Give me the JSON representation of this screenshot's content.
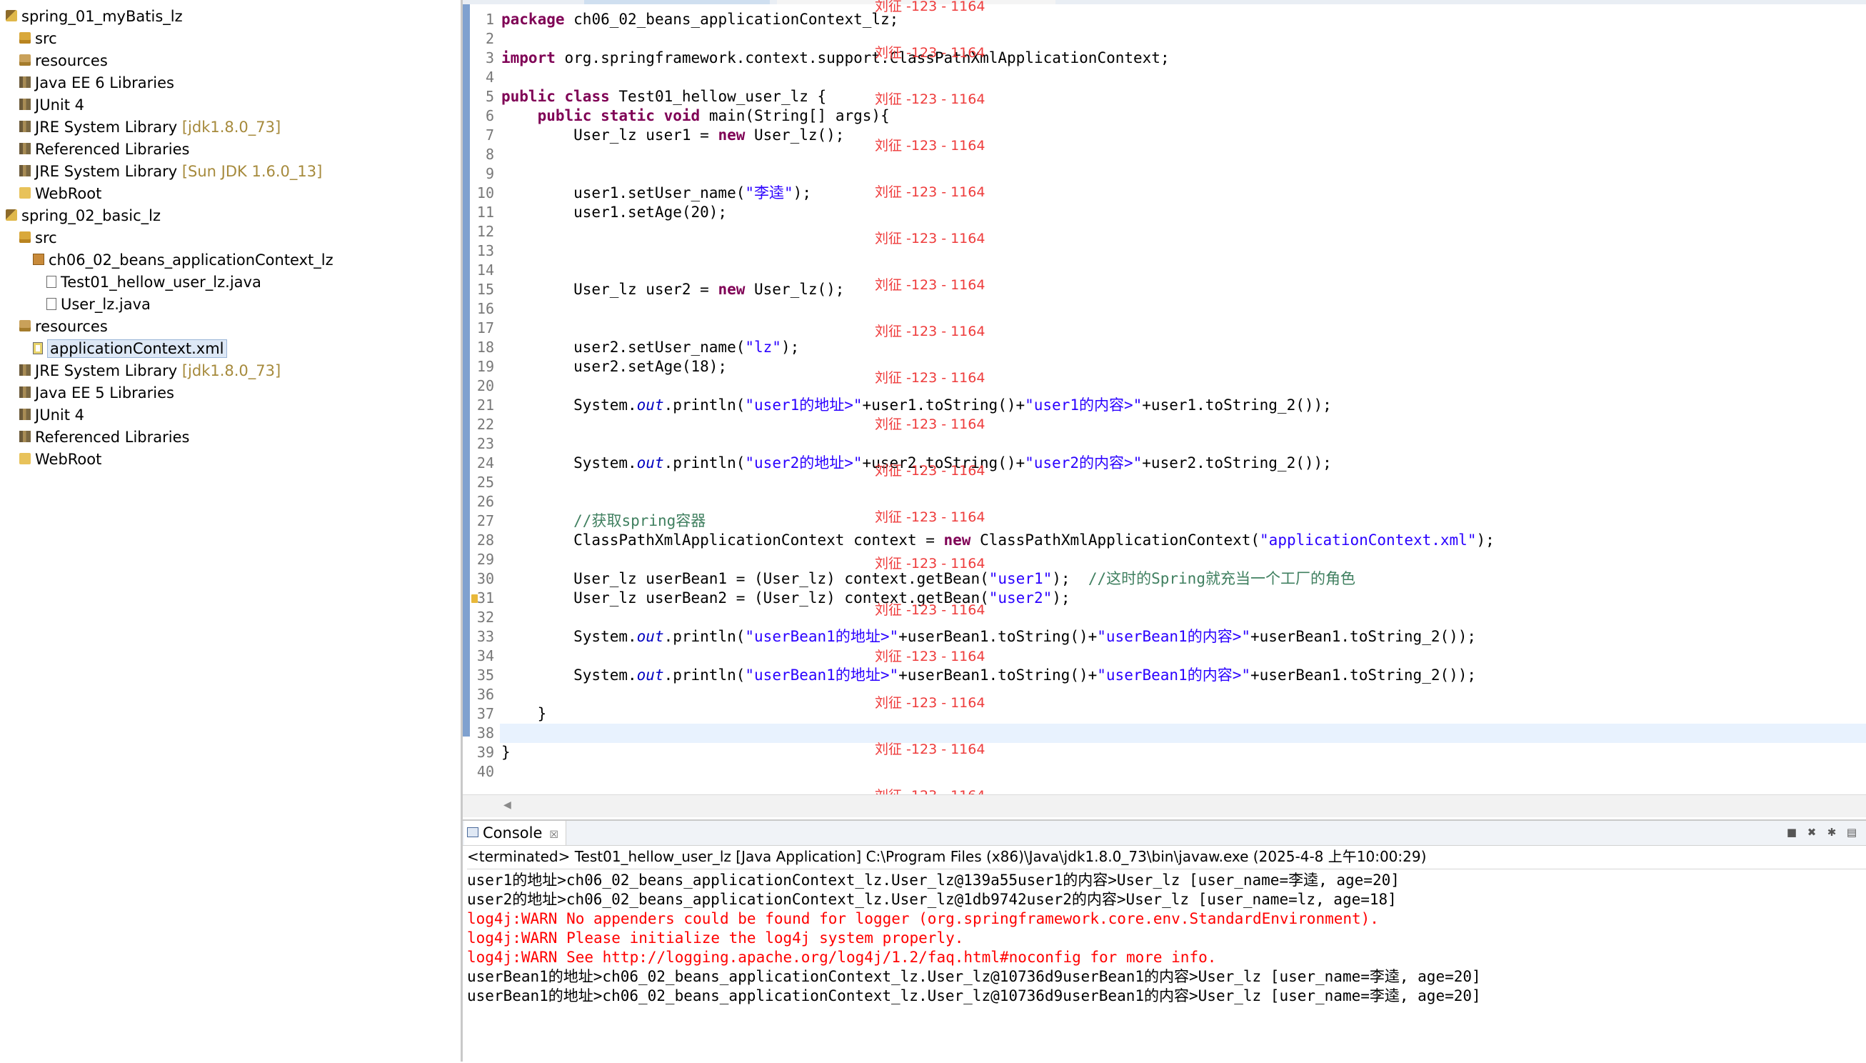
{
  "explorer": {
    "items": [
      {
        "label": "spring_01_myBatis_lz",
        "detail": "",
        "icon": "project-icon"
      },
      {
        "label": "src",
        "detail": "",
        "icon": "source-folder-icon"
      },
      {
        "label": "resources",
        "detail": "",
        "icon": "resource-folder-icon"
      },
      {
        "label": "Java EE 6 Libraries",
        "detail": "",
        "icon": "library-icon"
      },
      {
        "label": "JUnit 4",
        "detail": "",
        "icon": "library-icon"
      },
      {
        "label": "JRE System Library",
        "detail": "[jdk1.8.0_73]",
        "icon": "library-icon"
      },
      {
        "label": "Referenced Libraries",
        "detail": "",
        "icon": "library-icon"
      },
      {
        "label": "JRE System Library",
        "detail": "[Sun JDK 1.6.0_13]",
        "icon": "library-icon"
      },
      {
        "label": "WebRoot",
        "detail": "",
        "icon": "folder-icon"
      },
      {
        "label": "spring_02_basic_lz",
        "detail": "",
        "icon": "project-icon"
      },
      {
        "label": "src",
        "detail": "",
        "icon": "source-folder-icon"
      },
      {
        "label": "ch06_02_beans_applicationContext_lz",
        "detail": "",
        "icon": "package-icon"
      },
      {
        "label": "Test01_hellow_user_lz.java",
        "detail": "",
        "icon": "java-file-icon"
      },
      {
        "label": "User_lz.java",
        "detail": "",
        "icon": "java-file-icon"
      },
      {
        "label": "resources",
        "detail": "",
        "icon": "resource-folder-icon"
      },
      {
        "label": "applicationContext.xml",
        "detail": "",
        "icon": "xml-file-icon"
      },
      {
        "label": "JRE System Library",
        "detail": "[jdk1.8.0_73]",
        "icon": "library-icon"
      },
      {
        "label": "Java EE 5 Libraries",
        "detail": "",
        "icon": "library-icon"
      },
      {
        "label": "JUnit 4",
        "detail": "",
        "icon": "library-icon"
      },
      {
        "label": "Referenced Libraries",
        "detail": "",
        "icon": "library-icon"
      },
      {
        "label": "WebRoot",
        "detail": "",
        "icon": "folder-icon"
      }
    ],
    "selected_item": "applicationContext.xml"
  },
  "editor": {
    "file_name": "Test01_hellow_user_lz.java",
    "lines": [
      {
        "n": "1",
        "code": "package ch06_02_beans_applicationContext_lz;"
      },
      {
        "n": "2",
        "code": ""
      },
      {
        "n": "3",
        "code": "import org.springframework.context.support.ClassPathXmlApplicationContext;"
      },
      {
        "n": "4",
        "code": ""
      },
      {
        "n": "5",
        "code": "public class Test01_hellow_user_lz {"
      },
      {
        "n": "6",
        "code": "    public static void main(String[] args){"
      },
      {
        "n": "7",
        "code": "        User_lz user1 = new User_lz();"
      },
      {
        "n": "8",
        "code": ""
      },
      {
        "n": "9",
        "code": ""
      },
      {
        "n": "10",
        "code": "        user1.setUser_name(\"李逵\");"
      },
      {
        "n": "11",
        "code": "        user1.setAge(20);"
      },
      {
        "n": "12",
        "code": ""
      },
      {
        "n": "13",
        "code": ""
      },
      {
        "n": "14",
        "code": ""
      },
      {
        "n": "15",
        "code": "        User_lz user2 = new User_lz();"
      },
      {
        "n": "16",
        "code": ""
      },
      {
        "n": "17",
        "code": ""
      },
      {
        "n": "18",
        "code": "        user2.setUser_name(\"lz\");"
      },
      {
        "n": "19",
        "code": "        user2.setAge(18);"
      },
      {
        "n": "20",
        "code": ""
      },
      {
        "n": "21",
        "code": "        System.out.println(\"user1的地址>\"+user1.toString()+\"user1的内容>\"+user1.toString_2());"
      },
      {
        "n": "22",
        "code": ""
      },
      {
        "n": "23",
        "code": ""
      },
      {
        "n": "24",
        "code": "        System.out.println(\"user2的地址>\"+user2.toString()+\"user2的内容>\"+user2.toString_2());"
      },
      {
        "n": "25",
        "code": ""
      },
      {
        "n": "26",
        "code": ""
      },
      {
        "n": "27",
        "code": "        //获取spring容器"
      },
      {
        "n": "28",
        "code": "        ClassPathXmlApplicationContext context = new ClassPathXmlApplicationContext(\"applicationContext.xml\");"
      },
      {
        "n": "29",
        "code": ""
      },
      {
        "n": "30",
        "code": "        User_lz userBean1 = (User_lz) context.getBean(\"user1\");  //这时的Spring就充当一个工厂的角色"
      },
      {
        "n": "31",
        "code": "        User_lz userBean2 = (User_lz) context.getBean(\"user2\");"
      },
      {
        "n": "32",
        "code": ""
      },
      {
        "n": "33",
        "code": "        System.out.println(\"userBean1的地址>\"+userBean1.toString()+\"userBean1的内容>\"+userBean1.toString_2());"
      },
      {
        "n": "34",
        "code": ""
      },
      {
        "n": "35",
        "code": "        System.out.println(\"userBean1的地址>\"+userBean1.toString()+\"userBean1的内容>\"+userBean1.toString_2());"
      },
      {
        "n": "36",
        "code": ""
      },
      {
        "n": "37",
        "code": "    }"
      },
      {
        "n": "38",
        "code": ""
      },
      {
        "n": "39",
        "code": "}"
      },
      {
        "n": "40",
        "code": ""
      }
    ],
    "current_line": "38",
    "warning_line": "31"
  },
  "watermark": {
    "text": "刘征 -123 - 1164",
    "color": "#ee3b3b"
  },
  "console": {
    "tab_label": "Console",
    "close_symbol": "☒",
    "description": "<terminated> Test01_hellow_user_lz [Java Application] C:\\Program Files (x86)\\Java\\jdk1.8.0_73\\bin\\javaw.exe (2025-4-8 上午10:00:29)",
    "output": [
      {
        "text": "user1的地址>ch06_02_beans_applicationContext_lz.User_lz@139a55user1的内容>User_lz [user_name=李逵, age=20]",
        "kind": "normal"
      },
      {
        "text": "user2的地址>ch06_02_beans_applicationContext_lz.User_lz@1db9742user2的内容>User_lz [user_name=lz, age=18]",
        "kind": "normal"
      },
      {
        "text": "log4j:WARN No appenders could be found for logger (org.springframework.core.env.StandardEnvironment).",
        "kind": "err"
      },
      {
        "text": "log4j:WARN Please initialize the log4j system properly.",
        "kind": "err"
      },
      {
        "text": "log4j:WARN See http://logging.apache.org/log4j/1.2/faq.html#noconfig for more info.",
        "kind": "err"
      },
      {
        "text": "userBean1的地址>ch06_02_beans_applicationContext_lz.User_lz@10736d9userBean1的内容>User_lz [user_name=李逵, age=20]",
        "kind": "normal"
      },
      {
        "text": "userBean1的地址>ch06_02_beans_applicationContext_lz.User_lz@10736d9userBean1的内容>User_lz [user_name=李逵, age=20]",
        "kind": "normal"
      }
    ],
    "toolbar_icons": [
      "terminate-icon",
      "remove-launch-icon",
      "remove-all-icon",
      "more-icon"
    ]
  },
  "colors": {
    "keyword": "#7f0055",
    "string": "#2a00ff",
    "comment": "#3f7f5f",
    "static_field": "#0000c0",
    "error_output": "#ff0000",
    "current_line_highlight": "#e8f2fe",
    "library_detail": "#a68a3c"
  }
}
